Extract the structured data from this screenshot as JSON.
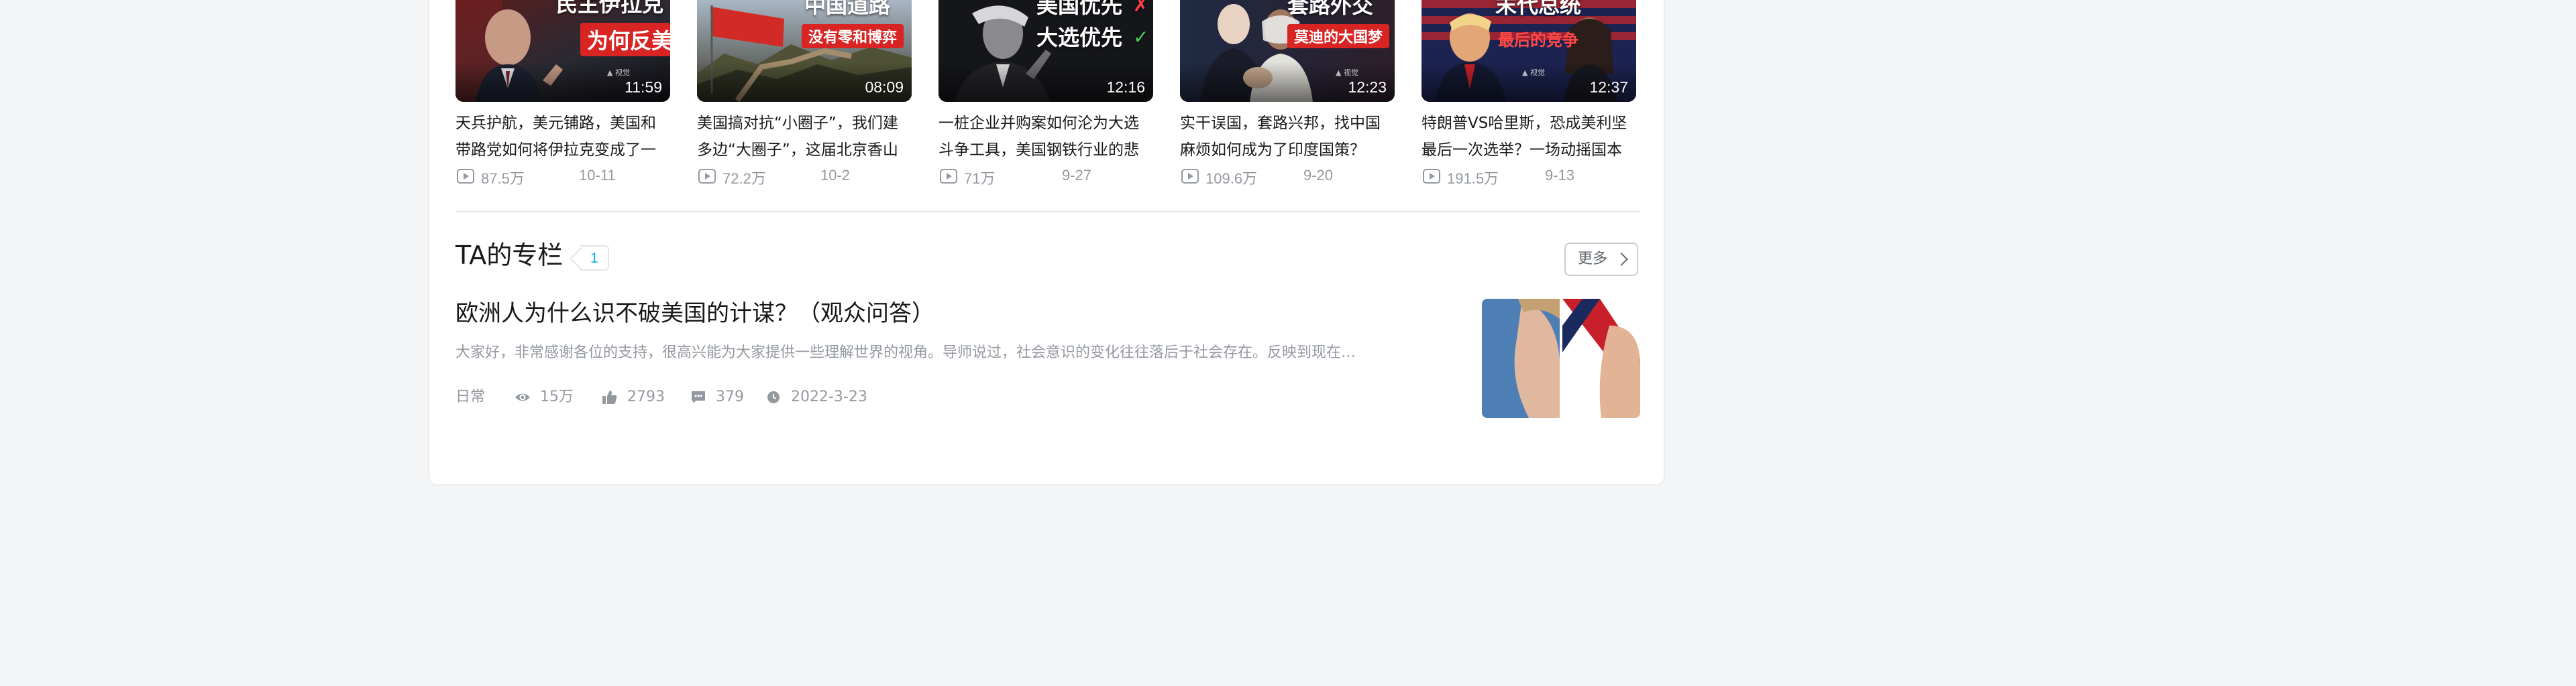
{
  "videos": [
    {
      "thumb_caption_line1": "民主伊拉克",
      "thumb_caption_line2": "为何反美",
      "duration": "11:59",
      "title": "天兵护航，美元铺路，美国和带路党如何将伊拉克变成了一",
      "views": "87.5万",
      "date": "10-11"
    },
    {
      "thumb_caption_line1": "中国道路",
      "thumb_caption_line2": "没有零和博弈",
      "duration": "08:09",
      "title": "美国搞对抗“小圈子”，我们建多边“大圈子”，这届北京香山",
      "views": "72.2万",
      "date": "10-2"
    },
    {
      "thumb_caption_line1": "美国优先",
      "thumb_caption_line2": "大选优先",
      "duration": "12:16",
      "title": "一桩企业并购案如何沦为大选斗争工具，美国钢铁行业的悲",
      "views": "71万",
      "date": "9-27"
    },
    {
      "thumb_caption_line1": "套路外交",
      "thumb_caption_line2": "莫迪的大国梦",
      "duration": "12:23",
      "title": "实干误国，套路兴邦，找中国麻烦如何成为了印度国策？",
      "views": "109.6万",
      "date": "9-20"
    },
    {
      "thumb_caption_line1": "末代总统",
      "thumb_caption_line2": "最后的竞争",
      "duration": "12:37",
      "title": "特朗普VS哈里斯，恐成美利坚最后一次选举？一场动摇国本",
      "views": "191.5万",
      "date": "9-13"
    }
  ],
  "column_section": {
    "title": "TA的专栏",
    "count": "1",
    "more_label": "更多",
    "article": {
      "title": "欧洲人为什么识不破美国的计谋？（观众问答）",
      "summary": "大家好，非常感谢各位的支持，很高兴能为大家提供一些理解世界的视角。导师说过，社会意识的变化往往落后于社会存在。反映到现在…",
      "category": "日常",
      "views": "15万",
      "likes": "2793",
      "comments": "379",
      "date": "2022-3-23"
    }
  },
  "colors": {
    "accent": "#00aeec",
    "muted_text": "#9499a0",
    "body_text": "#18191c",
    "page_bg": "#f4f5f7"
  },
  "icons": [
    "play-count-icon",
    "view-eye-icon",
    "like-thumb-icon",
    "comment-icon",
    "clock-icon",
    "chevron-right-icon"
  ]
}
